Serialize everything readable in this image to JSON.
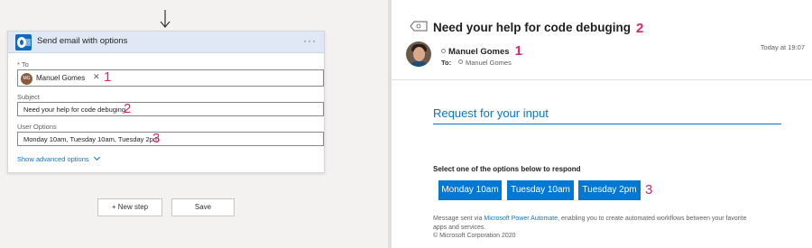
{
  "flow": {
    "card_title": "Send email with options",
    "to_label": "* To",
    "to_token": {
      "initials": "MG",
      "name": "Manuel Gomes"
    },
    "subject_label": "Subject",
    "subject_value": "Need your help for code debuging",
    "options_label": "User Options",
    "options_value": "Monday 10am, Tuesday 10am, Tuesday 2pm",
    "advanced_link": "Show advanced options",
    "new_step_label": "+ New step",
    "save_label": "Save"
  },
  "markers": {
    "one": "1",
    "two": "2",
    "three": "3"
  },
  "email": {
    "subject": "Need your help for code debuging",
    "sender": "Manuel Gomes",
    "to_label": "To:",
    "to_value": "Manuel Gomes",
    "time": "Today at 19:07",
    "heading": "Request for your input",
    "select_text": "Select one of the options below to respond",
    "options": [
      "Monday 10am",
      "Tuesday 10am",
      "Tuesday 2pm"
    ],
    "footer": {
      "prefix": "Message sent via ",
      "link": "Microsoft Power Automate",
      "suffix": ", enabling you to create automated workflows between your favorite",
      "line2": "apps and services.",
      "line3": "© Microsoft Corporation 2020"
    }
  },
  "colors": {
    "accent": "#0078d4",
    "marker": "#d6236f",
    "header_bg": "#dfe8f4"
  },
  "icons": [
    "arrow-down-icon",
    "outlook-icon",
    "more-icon",
    "close-icon",
    "chevron-down-icon",
    "reply-icon",
    "presence-icon"
  ]
}
